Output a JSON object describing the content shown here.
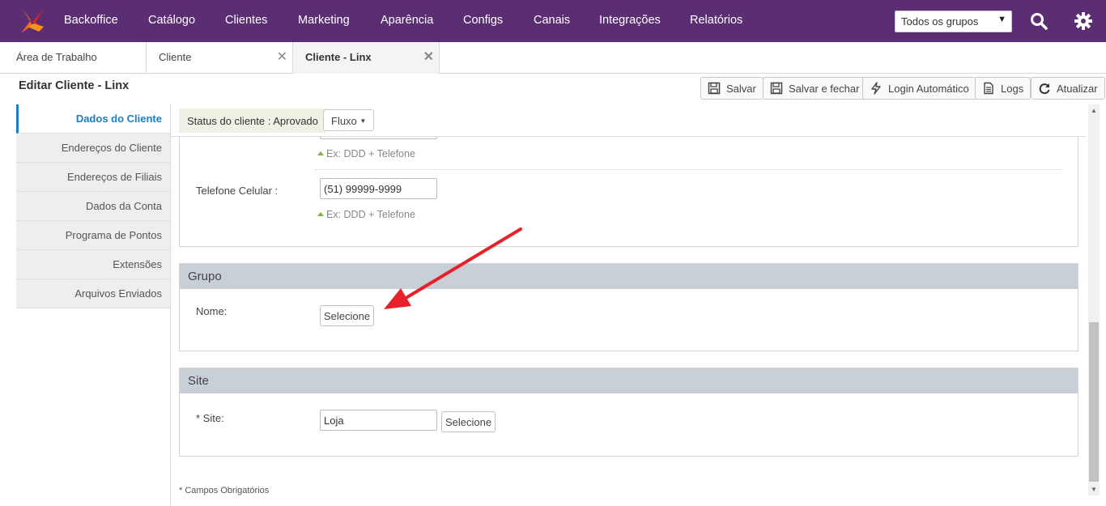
{
  "topbar": {
    "nav": [
      "Backoffice",
      "Catálogo",
      "Clientes",
      "Marketing",
      "Aparência",
      "Configs",
      "Canais",
      "Integrações",
      "Relatórios"
    ],
    "group_select": "Todos os grupos"
  },
  "tabs": [
    "Área de Trabalho",
    "Cliente",
    "Cliente - Linx"
  ],
  "header": {
    "title": "Editar Cliente - Linx",
    "buttons": [
      "Salvar",
      "Salvar e fechar",
      "Login Automático",
      "Logs",
      "Atualizar"
    ]
  },
  "sidebar": {
    "items": [
      "Dados do Cliente",
      "Endereços do Cliente",
      "Endereços de Filiais",
      "Dados da Conta",
      "Programa de Pontos",
      "Extensões",
      "Arquivos Enviados"
    ]
  },
  "status": {
    "text": "Status do cliente : Aprovado",
    "flow_label": "Fluxo"
  },
  "phone_section": {
    "hint_top": "Ex: DDD + Telefone",
    "cell_label": "Telefone Celular :",
    "cell_value": "(51) 99999-9999",
    "hint_bottom": "Ex: DDD + Telefone"
  },
  "group_section": {
    "title": "Grupo",
    "name_label": "Nome:",
    "select_button": "Selecione"
  },
  "site_section": {
    "title": "Site",
    "site_label": "* Site:",
    "site_value": "Loja",
    "select_button": "Selecione"
  },
  "footnote": "* Campos Obrigatórios",
  "colors": {
    "topbar": "#5b2e73",
    "accent": "#1a7ec8",
    "panel_header": "#c9cfd6",
    "arrow": "#e8202a"
  }
}
